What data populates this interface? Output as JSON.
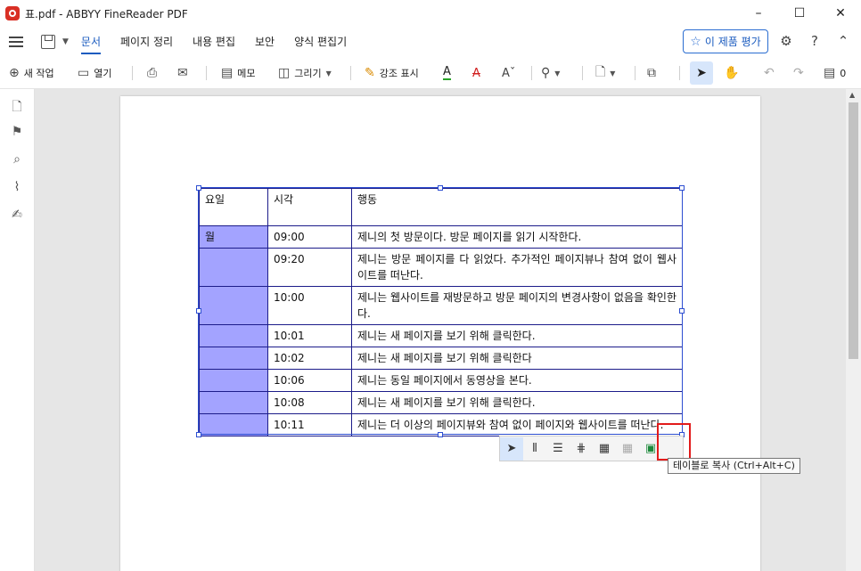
{
  "window": {
    "title": "표.pdf - ABBYY FineReader PDF",
    "controls": [
      "–",
      "☐",
      "✕"
    ]
  },
  "menu": {
    "tabs": [
      "문서",
      "페이지 정리",
      "내용 편집",
      "보안",
      "양식 편집기"
    ],
    "active_tab": "문서",
    "rate_button": "이 제품 평가"
  },
  "toolbar": {
    "new_task": "새 작업",
    "open": "열기",
    "memo": "메모",
    "draw": "그리기",
    "highlight": "강조 표시",
    "comment_count": "0"
  },
  "table": {
    "header": [
      "요일",
      "시각",
      "행동"
    ],
    "rows": [
      {
        "day": "월",
        "time": "09:00",
        "action": "제니의 첫 방문이다. 방문 페이지를 읽기 시작한다."
      },
      {
        "day": "",
        "time": "09:20",
        "action": "제니는 방문 페이지를 다 읽었다. 추가적인 페이지뷰나 참여 없이 웹사이트를 떠난다."
      },
      {
        "day": "",
        "time": "10:00",
        "action": "제니는 웹사이트를 재방문하고 방문 페이지의 변경사항이 없음을 확인한다."
      },
      {
        "day": "",
        "time": "10:01",
        "action": "제니는 새 페이지를 보기 위해 클릭한다."
      },
      {
        "day": "",
        "time": "10:02",
        "action": "제니는 새 페이지를 보기 위해 클릭한다"
      },
      {
        "day": "",
        "time": "10:06",
        "action": "제니는 동일 페이지에서 동영상을 본다."
      },
      {
        "day": "",
        "time": "10:08",
        "action": "제니는 새 페이지를 보기 위해 클릭한다."
      },
      {
        "day": "",
        "time": "10:11",
        "action": "제니는 더 이상의 페이지뷰와 참여 없이 페이지와 웹사이트를 떠난다."
      }
    ]
  },
  "tooltip": "테이블로 복사 (Ctrl+Alt+C)",
  "colors": {
    "accent": "#1a5bbf",
    "table_border": "#1c1c8a",
    "cell_highlight": "#a3a3ff",
    "highlight_box": "#e21b1b"
  }
}
